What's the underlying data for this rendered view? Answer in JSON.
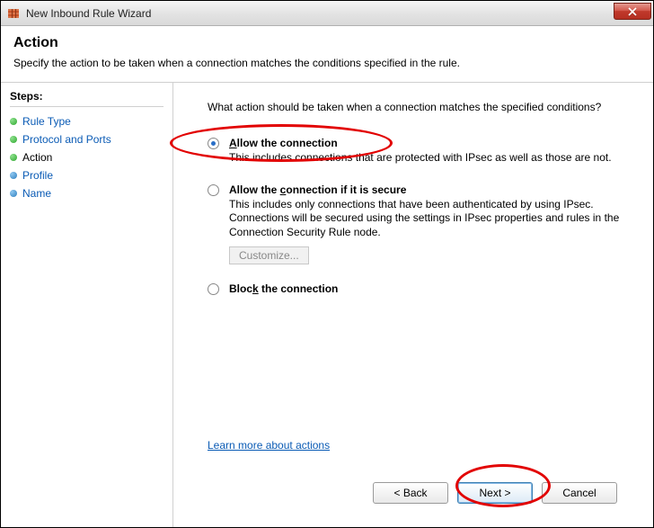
{
  "window": {
    "title": "New Inbound Rule Wizard"
  },
  "header": {
    "title": "Action",
    "subtitle": "Specify the action to be taken when a connection matches the conditions specified in the rule."
  },
  "sidebar": {
    "heading": "Steps:",
    "items": [
      {
        "label": "Rule Type",
        "state": "done"
      },
      {
        "label": "Protocol and Ports",
        "state": "done"
      },
      {
        "label": "Action",
        "state": "current"
      },
      {
        "label": "Profile",
        "state": "pending"
      },
      {
        "label": "Name",
        "state": "pending"
      }
    ]
  },
  "main": {
    "prompt": "What action should be taken when a connection matches the specified conditions?",
    "options": [
      {
        "id": "allow",
        "mnemonic": "A",
        "title_rest": "llow the connection",
        "desc": "This includes connections that are protected with IPsec as well as those are not.",
        "selected": true
      },
      {
        "id": "allow-secure",
        "mnemonic": "",
        "title_pre": "Allow the ",
        "mn_c": "c",
        "title_post": "onnection if it is secure",
        "desc": "This includes only connections that have been authenticated by using IPsec.  Connections will be secured using the settings in IPsec properties and rules in the Connection Security Rule node.",
        "customize_label": "Customize...",
        "selected": false
      },
      {
        "id": "block",
        "mnemonic": "",
        "title_pre": "Bloc",
        "mn_c": "k",
        "title_post": " the connection",
        "desc": "",
        "selected": false
      }
    ],
    "learn_more": "Learn more about actions"
  },
  "buttons": {
    "back": "< Back",
    "next": "Next >",
    "cancel": "Cancel"
  },
  "annotations": {
    "circled_option": "allow",
    "circled_button": "next"
  }
}
